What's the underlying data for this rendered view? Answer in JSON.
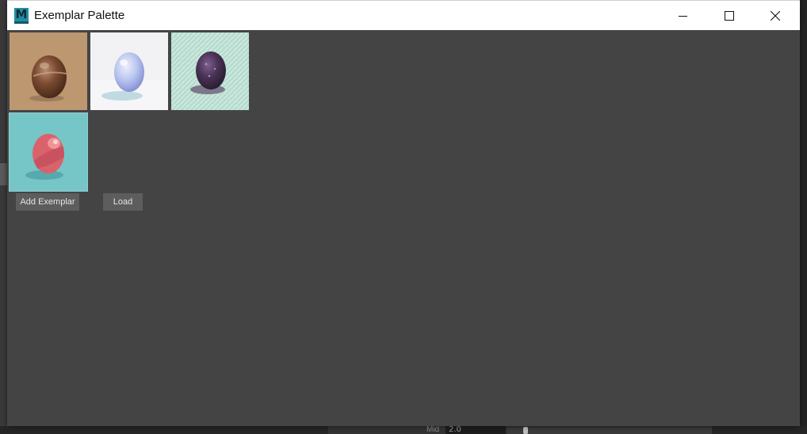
{
  "window": {
    "title": "Exemplar Palette",
    "app_icon_letter": "M",
    "controls": [
      "minimize-icon",
      "maximize-icon",
      "close-icon"
    ]
  },
  "exemplars": [
    {
      "name": "brown-sketch-egg",
      "bg": "#b8926a",
      "egg": "#7a4a30"
    },
    {
      "name": "white-pastel-egg",
      "bg": "#f2f2f4",
      "egg": "#b9c6ee"
    },
    {
      "name": "mint-crayon-egg",
      "bg": "#b7dccf",
      "egg": "#4b3356"
    },
    {
      "name": "teal-flat-egg",
      "bg": "#76c6c8",
      "egg": "#d9626c",
      "selected": true
    }
  ],
  "buttons": {
    "add_exemplar": "Add Exemplar",
    "load": "Load"
  },
  "background": {
    "field_label": "Mid",
    "field_value": "2.0"
  },
  "colors": {
    "window_bg": "#444444",
    "button_bg": "#5d5d5d",
    "titlebar_bg": "#ffffff"
  }
}
